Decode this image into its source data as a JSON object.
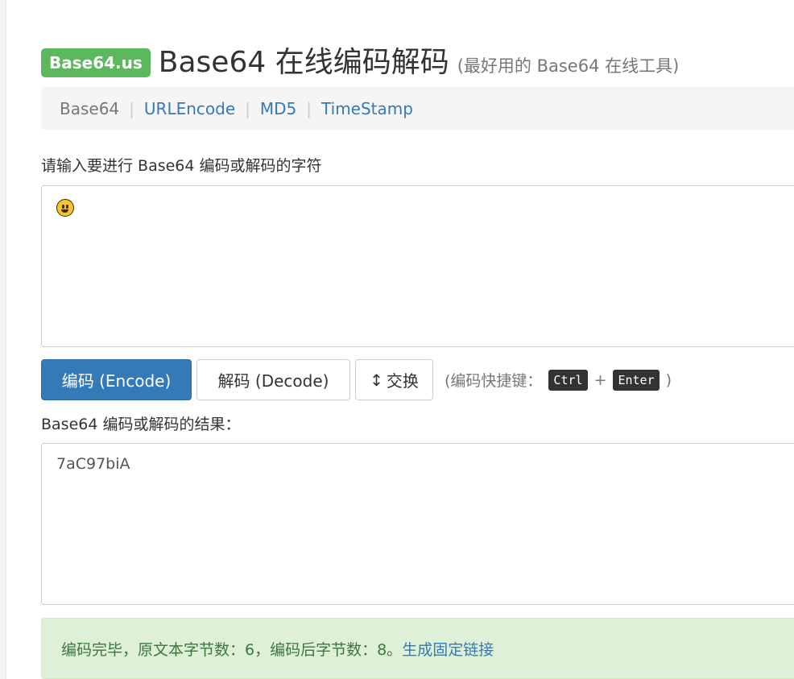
{
  "header": {
    "brand": "Base64.us",
    "title": "Base64 在线编码解码",
    "subtitle": "(最好用的 Base64 在线工具)"
  },
  "nav": {
    "items": [
      {
        "label": "Base64",
        "active": true
      },
      {
        "label": "URLEncode",
        "active": false
      },
      {
        "label": "MD5",
        "active": false
      },
      {
        "label": "TimeStamp",
        "active": false
      }
    ],
    "separator": "|"
  },
  "input": {
    "label": "请输入要进行 Base64 编码或解码的字符",
    "value_icon": "grinning-face-emoji"
  },
  "buttons": {
    "encode": "编码 (Encode)",
    "decode": "解码 (Decode)",
    "swap_glyph": "↕",
    "swap": "交换"
  },
  "hint": {
    "prefix": "(编码快捷键：",
    "key1": "Ctrl",
    "plus": "+",
    "key2": "Enter",
    "suffix": ")"
  },
  "output": {
    "label": "Base64 编码或解码的结果：",
    "value": "7aC97biA"
  },
  "status": {
    "message": "编码完毕，原文本字节数：6，编码后字节数：8。",
    "link": "生成固定链接"
  },
  "colors": {
    "brand": "#5cb85c",
    "primary": "#337ab7",
    "success_bg": "#dff0d8",
    "success_text": "#3c763d"
  }
}
